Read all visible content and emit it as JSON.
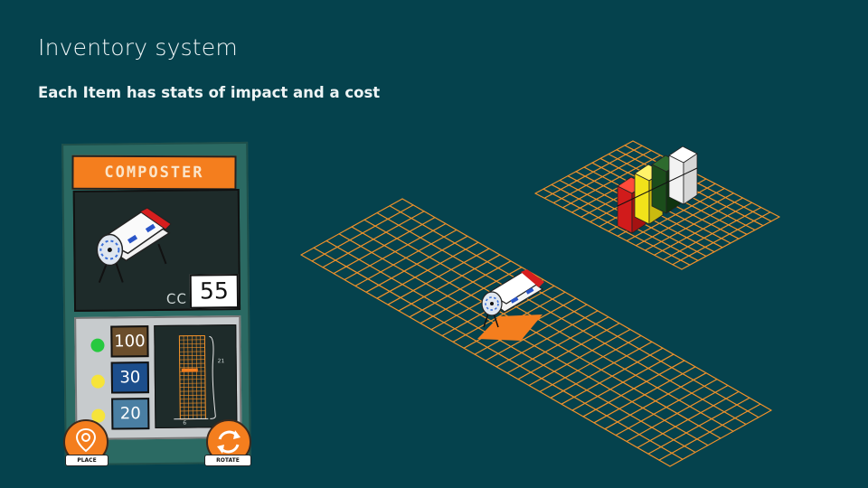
{
  "slide": {
    "title": "Inventory system",
    "subtitle": "Each Item has stats of impact and a cost"
  },
  "card": {
    "item_name": "Composter",
    "cost_label": "CC",
    "cost_value": "55",
    "stats": [
      {
        "value": "100",
        "dot_color": "#27c93f",
        "box_color": "#6b4e2c"
      },
      {
        "value": "30",
        "dot_color": "#f6e43a",
        "box_color": "#1c4e8c"
      },
      {
        "value": "20",
        "dot_color": "#f6e43a",
        "box_color": "#4a7fa3"
      }
    ],
    "footprint": {
      "width": "6",
      "height": "21"
    },
    "place_label": "PLACE",
    "rotate_label": "ROTATE",
    "place_icon": "map-pin-icon",
    "rotate_icon": "rotate-arrows-icon"
  },
  "colors": {
    "background": "#05424d",
    "accent_orange": "#f47e1e",
    "grid_line": "#f2922a",
    "impact_bars": [
      "#d11b1b",
      "#f1e21a",
      "#1b4d1b",
      "#ffffff"
    ]
  }
}
